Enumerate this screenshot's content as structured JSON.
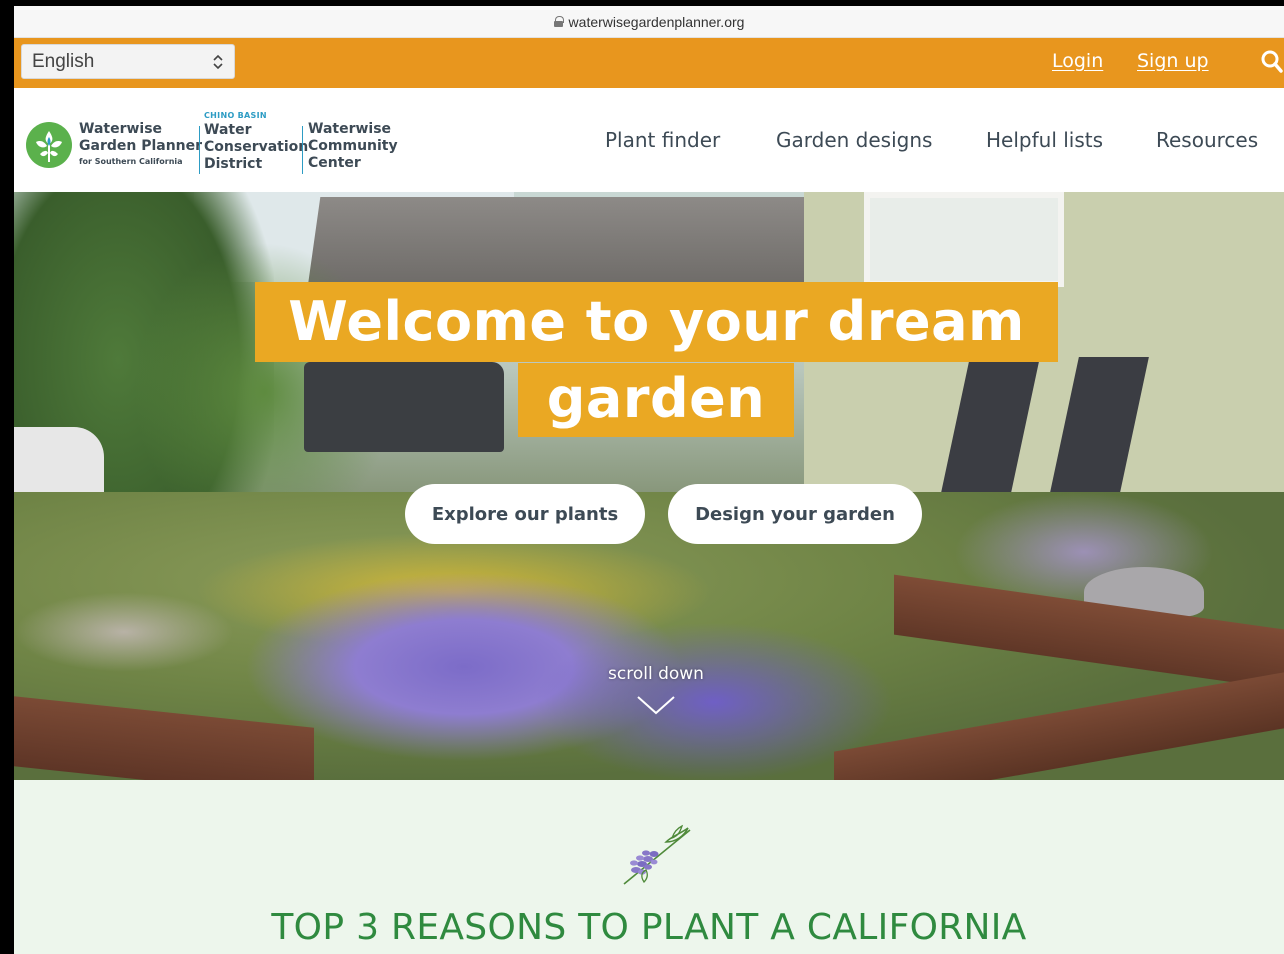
{
  "browser": {
    "url": "waterwisegardenplanner.org"
  },
  "topbar": {
    "language": "English",
    "login": "Login",
    "signup": "Sign up",
    "search_icon": "search-icon",
    "bg_color": "#e8961e"
  },
  "header": {
    "brand1": {
      "line1": "Waterwise",
      "line2": "Garden Planner",
      "line3": "for Southern California"
    },
    "brand2": {
      "small": "CHINO BASIN",
      "line1": "Water",
      "line2": "Conservation",
      "line3": "District"
    },
    "brand3": {
      "line1": "Waterwise",
      "line2": "Community",
      "line3": "Center"
    },
    "nav": [
      "Plant finder",
      "Garden designs",
      "Helpful lists",
      "Resources"
    ]
  },
  "hero": {
    "title_line1": "Welcome to your dream",
    "title_line2": "garden",
    "cta_explore": "Explore our plants",
    "cta_design": "Design your garden",
    "scroll_label": "scroll down",
    "accent_color": "#eaa823"
  },
  "reasons": {
    "title": "TOP 3 REASONS TO PLANT A CALIFORNIA",
    "title_color": "#2f8a3f",
    "bg_color": "#edf6ec"
  }
}
